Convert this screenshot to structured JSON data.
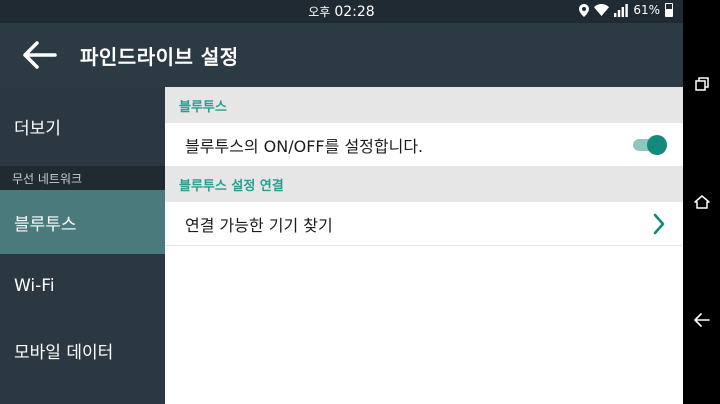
{
  "status_bar": {
    "ampm": "오후",
    "time": "02:28",
    "battery": "61%",
    "battery_level": 0.61,
    "icons": [
      "location-icon",
      "wifi-icon",
      "signal-icon",
      "battery-icon"
    ]
  },
  "app_bar": {
    "back_icon": "arrow-left-icon",
    "title": "파인드라이브 설정"
  },
  "sidebar": {
    "items": [
      {
        "label": "더보기"
      },
      {
        "label": "블루투스",
        "active": true
      },
      {
        "label": "Wi-Fi"
      },
      {
        "label": "모바일 데이터"
      }
    ],
    "section_label": "무선 네트워크"
  },
  "main": {
    "section1_header": "블루투스",
    "toggle_row_label": "블루투스의 ON/OFF를 설정합니다.",
    "toggle_on": true,
    "section2_header": "블루투스 설정 연결",
    "find_devices_label": "연결 가능한 기기 찾기"
  },
  "nav_bar": {
    "icons": [
      "recent-apps-icon",
      "home-icon",
      "back-icon"
    ]
  },
  "colors": {
    "accent": "#2a9d8f",
    "toggle_thumb": "#138a7c",
    "toggle_track": "#8fc6c0",
    "sidebar_active": "#4a7a7b"
  }
}
